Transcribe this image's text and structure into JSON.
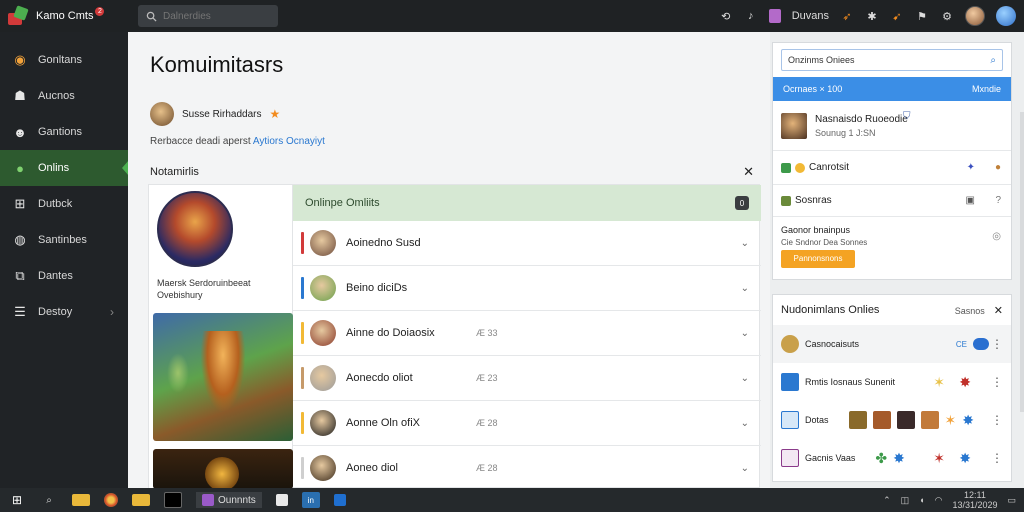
{
  "topbar": {
    "app_name": "Kamo Cmts",
    "badge": "2",
    "search_placeholder": "Dalnerdies",
    "right_label": "Duvans"
  },
  "sidebar": {
    "items": [
      {
        "label": "Gonltans",
        "icon": "globe-icon"
      },
      {
        "label": "Aucnos",
        "icon": "users-icon"
      },
      {
        "label": "Gantions",
        "icon": "person-icon"
      },
      {
        "label": "Onlins",
        "icon": "chat-icon",
        "active": true
      },
      {
        "label": "Dutbck",
        "icon": "add-box-icon"
      },
      {
        "label": "Santinbes",
        "icon": "circle-user-icon"
      },
      {
        "label": "Dantes",
        "icon": "share-box-icon"
      },
      {
        "label": "Destoy",
        "icon": "list-icon"
      }
    ]
  },
  "main": {
    "title": "Komuimitasrs",
    "user_name": "Susse Rirhaddars",
    "user_desc": "Rerbacce deadi aperst",
    "user_link": "Aytiors Ocnayiyt",
    "panel_heading": "Notamirlis",
    "hero_caption": "Maersk Serdoruinbeeat Ovebishury",
    "group_title": "Onlinpe Omliits",
    "group_count": "0",
    "members": [
      {
        "name": "Aoinedno Susd",
        "meta": "",
        "bar_color": "#d23a3a",
        "av": "#6c4a3a"
      },
      {
        "name": "Beino diciDs",
        "meta": "",
        "bar_color": "#2a78d0",
        "av": "#6aa04a"
      },
      {
        "name": "Ainne do Doiaosix",
        "meta": "Æ 33",
        "bar_color": "#f2b935",
        "av": "#8a3a2a"
      },
      {
        "name": "Aonecdo oliot",
        "meta": "Æ 23",
        "bar_color": "#c69a6a",
        "av": "#9a9a9a"
      },
      {
        "name": "Aonne Oln ofiX",
        "meta": "Æ 28",
        "bar_color": "#f2b935",
        "av": "#1a1a1a"
      },
      {
        "name": "Aoneo diol",
        "meta": "Æ 28",
        "bar_color": "#cfcfcf",
        "av": "#3a2a1a"
      }
    ]
  },
  "right": {
    "search_value": "Onzinms Oniees",
    "tab_label": "Ocrnaes × 100",
    "tab_right": "Mxndie",
    "friend_name": "Nasnaisdo Ruoeodie",
    "friend_sub": "Sounug 1 J:SN",
    "row2_label": "Canrotsit",
    "row3_label": "Sosnras",
    "row4_title": "Gaonor bnainpus",
    "row4_sub": "Cie Sndnor Dea Sonnes",
    "row4_button": "Pannonsnons",
    "online_title": "Nudonimlans Onlies",
    "online_action": "Sasnos",
    "online_rows": [
      {
        "label": "Casnocaisuts",
        "tag": "CE"
      },
      {
        "label": "Rmtis Iosnaus Sunenit",
        "tag": ""
      },
      {
        "label": "Dotas",
        "tag": ""
      },
      {
        "label": "Gacnis Vaas",
        "tag": ""
      }
    ]
  },
  "taskbar": {
    "active_app": "Ounnnts",
    "time": "12:11",
    "date": "13/31/2029"
  }
}
